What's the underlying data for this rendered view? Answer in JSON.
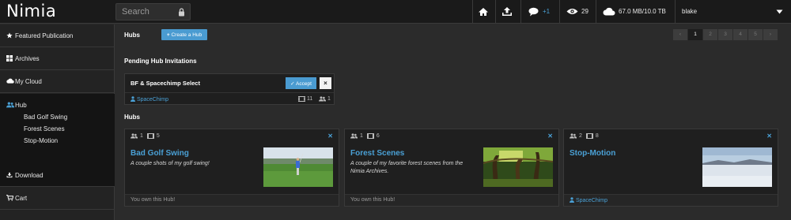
{
  "app": {
    "logo": "Nimia"
  },
  "search": {
    "placeholder": "Search"
  },
  "topbar": {
    "notification_count": "+1",
    "views_count": "29",
    "storage": "67.0 MB/10.0 TB",
    "user": "blake"
  },
  "sidebar": {
    "items": [
      {
        "label": "Featured Publication",
        "icon": "star-icon"
      },
      {
        "label": "Archives",
        "icon": "grid-icon"
      },
      {
        "label": "My Cloud",
        "icon": "cloud-icon"
      },
      {
        "label": "Hub",
        "icon": "users-icon"
      },
      {
        "label": "Download",
        "icon": "download-icon"
      },
      {
        "label": "Cart",
        "icon": "cart-icon"
      }
    ],
    "hub_children": [
      "Bad Golf Swing",
      "Forest Scenes",
      "Stop-Motion"
    ]
  },
  "page": {
    "title": "Hubs",
    "create_button": "Create a Hub",
    "pagination": [
      "‹",
      "1",
      "2",
      "3",
      "4",
      "5",
      "›"
    ],
    "pagination_active": "1"
  },
  "invitations": {
    "heading": "Pending Hub Invitations",
    "items": [
      {
        "name": "BF & Spacechimp Select",
        "accept": "Accept",
        "decline": "×",
        "owner": "SpaceChimp",
        "clips": "11",
        "members": "1"
      }
    ]
  },
  "hubs": {
    "heading": "Hubs",
    "items": [
      {
        "members": "1",
        "clips": "5",
        "title": "Bad Golf Swing",
        "description": "A couple shots of my golf swing!",
        "footer": "You own this Hub!"
      },
      {
        "members": "1",
        "clips": "6",
        "title": "Forest Scenes",
        "description": "A couple of my favorite forest scenes from the Nimia Archives.",
        "footer": "You own this Hub!"
      },
      {
        "members": "2",
        "clips": "8",
        "title": "Stop-Motion",
        "description": "",
        "footer_owner": "SpaceChimp"
      }
    ]
  },
  "colors": {
    "accent": "#4a9bd1",
    "link": "#4aa0d5",
    "topbar": "#1a1a1a",
    "background": "#2b2b2b"
  }
}
